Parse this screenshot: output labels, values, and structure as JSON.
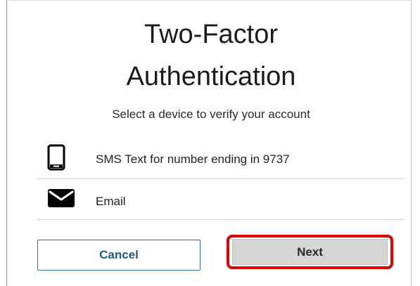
{
  "header": {
    "title_line1": "Two-Factor",
    "title_line2": "Authentication",
    "subtitle": "Select a device to verify your account"
  },
  "options": [
    {
      "icon": "phone-icon",
      "label": "SMS Text for number ending in 9737"
    },
    {
      "icon": "envelope-icon",
      "label": "Email"
    }
  ],
  "actions": {
    "cancel_label": "Cancel",
    "next_label": "Next"
  },
  "colors": {
    "highlight": "#e00000",
    "link_blue": "#1f5c8a",
    "next_bg": "#d5d5d5"
  }
}
